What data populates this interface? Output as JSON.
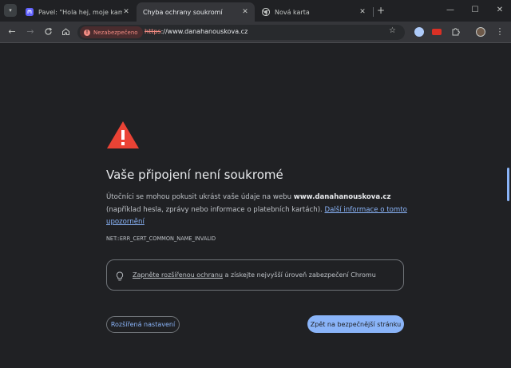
{
  "tabs": [
    {
      "title": "Pavel: \"Hola hej, moje kamarádi",
      "close": "✕",
      "favicon": "mastodon-icon"
    },
    {
      "title": "Chyba ochrany soukromí",
      "close": "✕",
      "favicon": "none"
    },
    {
      "title": "Nová karta",
      "close": "✕",
      "favicon": "chrome-icon"
    }
  ],
  "window_controls": {
    "new_tab": "+",
    "minimize": "—",
    "maximize": "☐",
    "close": "✕"
  },
  "toolbar": {
    "security_chip": "Nezabezpečeno",
    "url_scheme": "https",
    "url_rest": "://www.danahanouskova.cz"
  },
  "interstitial": {
    "heading": "Vaše připojení není soukromé",
    "body_part1": "Útočníci se mohou pokusit ukrást vaše údaje na webu ",
    "domain": "www.danahanouskova.cz",
    "body_part2": " (například hesla, zprávy nebo informace o platebních kartách). ",
    "learn_more": "Další informace o tomto upozornění",
    "error_code": "NET::ERR_CERT_COMMON_NAME_INVALID",
    "protect_link": "Zapněte rozšířenou ochranu",
    "protect_text": " a získejte nejvyšší úroveň zabezpečení Chromu",
    "advanced_button": "Rozšířená nastavení",
    "back_button": "Zpět na bezpečnější stránku"
  },
  "colors": {
    "accent": "#8ab4f8",
    "warning_red": "#ea4335",
    "background": "#202124"
  }
}
